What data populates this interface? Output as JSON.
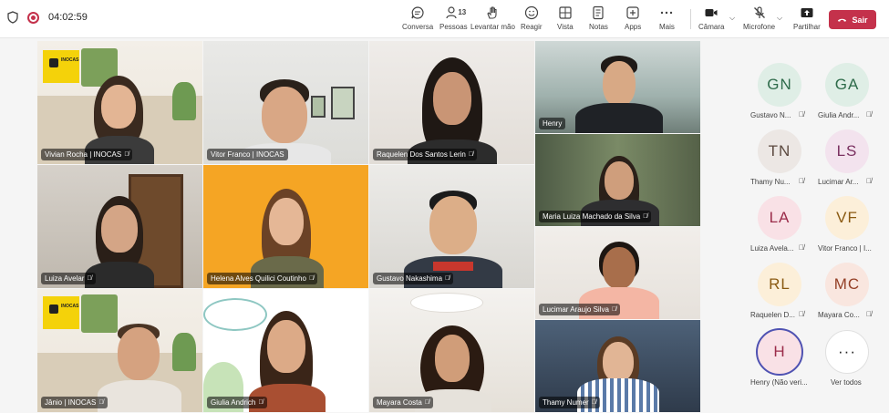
{
  "timer": "04:02:59",
  "toolbar": {
    "chat": "Conversa",
    "people": "Pessoas",
    "people_count": "13",
    "raise_hand": "Levantar mão",
    "react": "Reagir",
    "view": "Vista",
    "notes": "Notas",
    "apps": "Apps",
    "more": "Mais",
    "camera": "Câmara",
    "mic": "Microfone",
    "share": "Partilhar",
    "leave": "Sair"
  },
  "tiles": [
    {
      "name": "Vivian Rocha | INOCAS"
    },
    {
      "name": "Vitor Franco | INOCAS"
    },
    {
      "name": "Raquelen Dos Santos Lerin"
    },
    {
      "name": "Henry"
    },
    {
      "name": "Maria Luiza Machado da Silva"
    },
    {
      "name": "Luiza Avelar"
    },
    {
      "name": "Helena Alves Quilici Coutinho"
    },
    {
      "name": "Gustavo Nakashima"
    },
    {
      "name": "Lucimar Araujo Silva"
    },
    {
      "name": "Jânio | INOCAS"
    },
    {
      "name": "Giulia Andrich"
    },
    {
      "name": "Mayara Costa"
    },
    {
      "name": "Thamy Numer"
    }
  ],
  "logo_text": "INOCAS",
  "roster": [
    {
      "initials": "GN",
      "label": "Gustavo N...",
      "bg": "#dfeee6",
      "fg": "#2e6b4a"
    },
    {
      "initials": "GA",
      "label": "Giulia Andr...",
      "bg": "#dfeee6",
      "fg": "#2e6b4a"
    },
    {
      "initials": "TN",
      "label": "Thamy Nu...",
      "bg": "#ece7e4",
      "fg": "#5c4a40"
    },
    {
      "initials": "LS",
      "label": "Lucimar Ar...",
      "bg": "#f3e3ee",
      "fg": "#7a3060"
    },
    {
      "initials": "LA",
      "label": "Luiza Avela...",
      "bg": "#f9e1e6",
      "fg": "#9b2c4a"
    },
    {
      "initials": "VF",
      "label": "Vitor Franco | I...",
      "bg": "#fcefd9",
      "fg": "#8a5a12"
    },
    {
      "initials": "RL",
      "label": "Raquelen D...",
      "bg": "#fcefd9",
      "fg": "#8a5a12"
    },
    {
      "initials": "MC",
      "label": "Mayara Co...",
      "bg": "#f9e6df",
      "fg": "#943f26"
    },
    {
      "initials": "H",
      "label": "Henry (Não veri...",
      "bg": "#f9e1e6",
      "fg": "#9b2c4a"
    },
    {
      "initials": "···",
      "label": "Ver todos",
      "bg": "#ffffff",
      "fg": "#242424"
    }
  ]
}
